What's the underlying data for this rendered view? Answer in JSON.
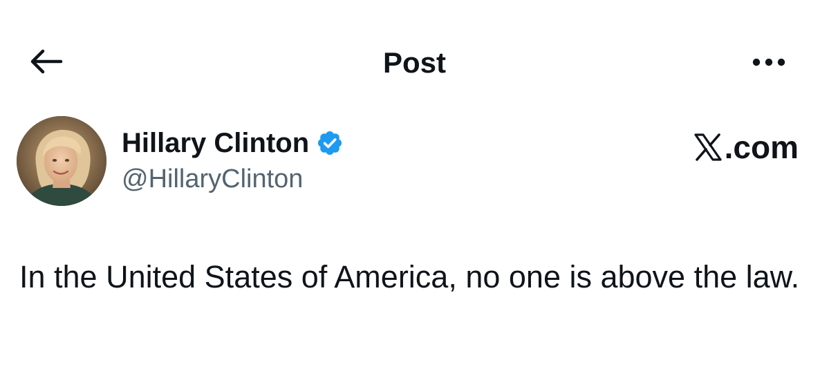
{
  "header": {
    "title": "Post",
    "back_icon": "arrow-left-icon",
    "more_icon": "more-horizontal-icon"
  },
  "author": {
    "display_name": "Hillary Clinton",
    "handle": "@HillaryClinton",
    "verified": true,
    "verified_color": "#1d9bf0",
    "avatar_icon": "profile-photo"
  },
  "watermark": {
    "logo_icon": "x-logo-icon",
    "text": ".com"
  },
  "post": {
    "text": "In the United States of America, no one is above the law."
  },
  "colors": {
    "text_primary": "#0f1419",
    "text_secondary": "#536471",
    "background": "#ffffff"
  }
}
